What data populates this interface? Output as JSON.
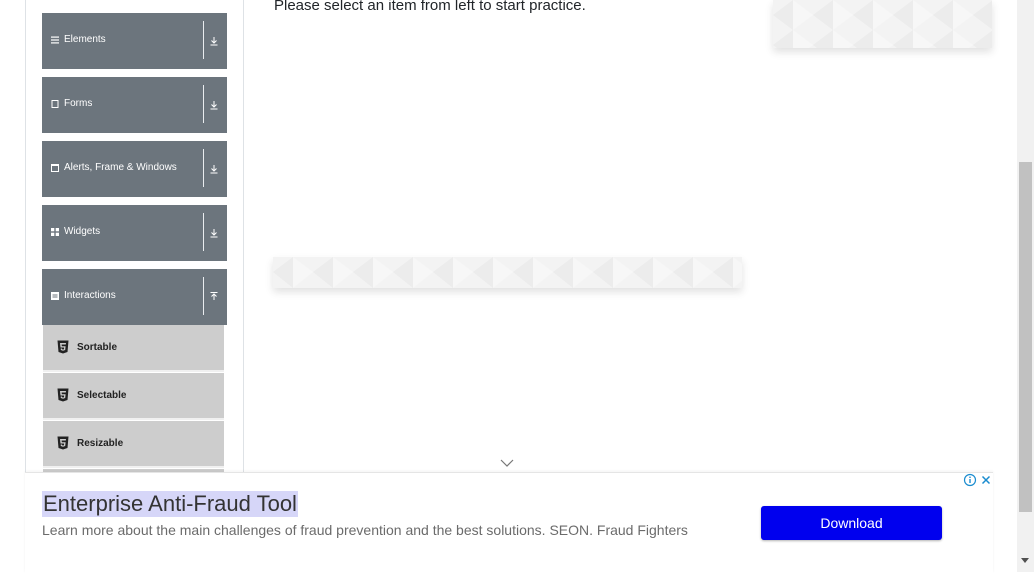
{
  "sidebar": {
    "groups": [
      {
        "label": "Elements",
        "icon": "menu-icon",
        "state": "collapsed"
      },
      {
        "label": "Forms",
        "icon": "form-icon",
        "state": "collapsed"
      },
      {
        "label": "Alerts, Frame & Windows",
        "icon": "window-icon",
        "state": "collapsed"
      },
      {
        "label": "Widgets",
        "icon": "widgets-icon",
        "state": "collapsed"
      },
      {
        "label": "Interactions",
        "icon": "interactions-icon",
        "state": "expanded"
      }
    ],
    "items": [
      {
        "label": "Sortable",
        "icon": "html5-icon"
      },
      {
        "label": "Selectable",
        "icon": "html5-icon"
      },
      {
        "label": "Resizable",
        "icon": "html5-icon"
      }
    ]
  },
  "main": {
    "practice_text": "Please select an item from left to start practice."
  },
  "ad": {
    "title": "Enterprise Anti-Fraud Tool",
    "description": "Learn more about the main challenges of fraud prevention and the best solutions. SEON. Fraud Fighters",
    "button_label": "Download"
  },
  "colors": {
    "group_bg": "#6c757d",
    "subitem_bg": "#cdcdcd",
    "download_bg": "#0000ee",
    "title_highlight": "#d6d6f8"
  }
}
